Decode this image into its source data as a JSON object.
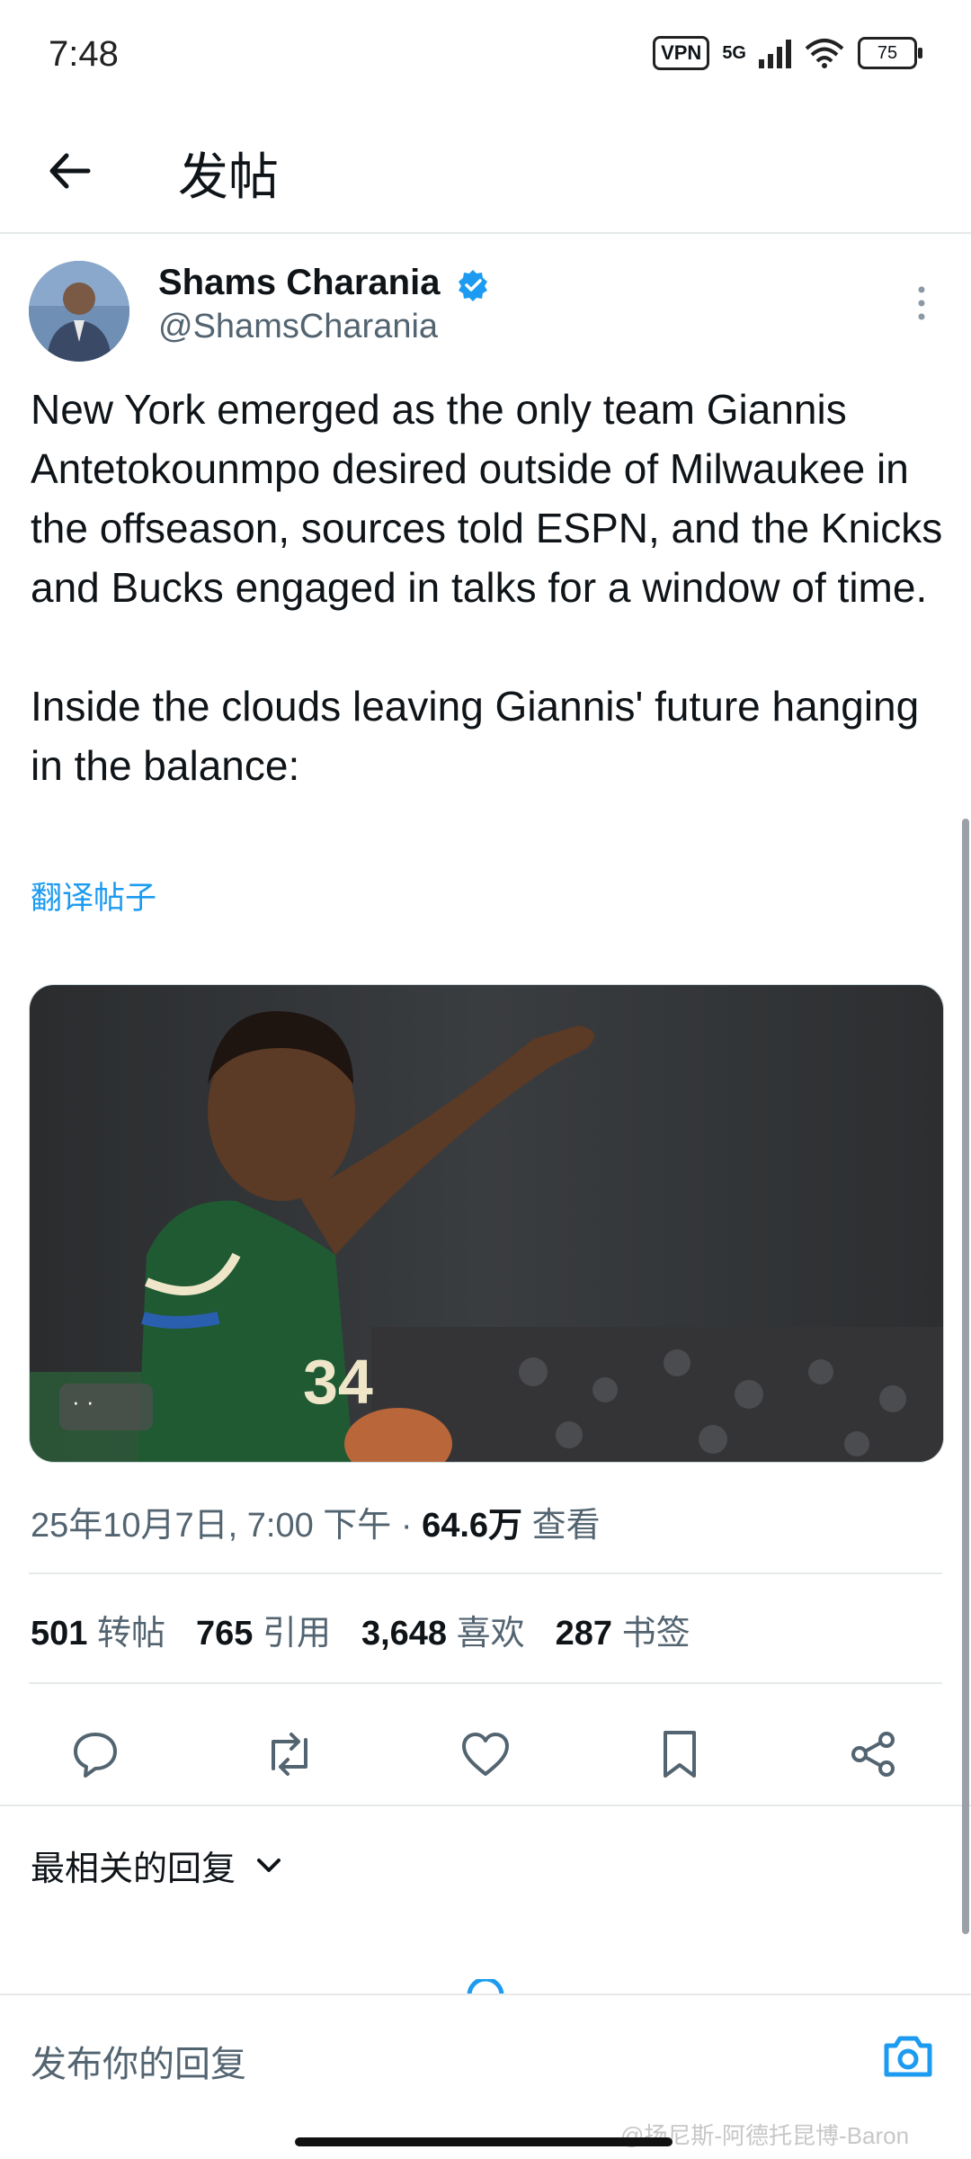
{
  "status": {
    "time": "7:48",
    "vpn": "VPN",
    "network": "5G",
    "battery": "75"
  },
  "header": {
    "title": "发帖"
  },
  "tweet": {
    "author_name": "Shams Charania",
    "author_handle": "@ShamsCharania",
    "body": "New York emerged as the only team Giannis Antetokounmpo desired outside of Milwaukee in the offseason, sources told ESPN, and the Knicks and Bucks engaged in talks for a window of time.\n\nInside the clouds leaving Giannis' future hanging in the balance:",
    "translate_label": "翻译帖子",
    "alt_badge": "· ·",
    "jersey_text": "34",
    "timestamp": "25年10月7日, 7:00 下午",
    "separator": "·",
    "views_count": "64.6万",
    "views_label": "查看"
  },
  "stats": [
    {
      "count": "501",
      "label": "转帖"
    },
    {
      "count": "765",
      "label": "引用"
    },
    {
      "count": "3,648",
      "label": "喜欢"
    },
    {
      "count": "287",
      "label": "书签"
    }
  ],
  "actions": {
    "reply_icon": "reply-icon",
    "retweet_icon": "retweet-icon",
    "like_icon": "heart-icon",
    "bookmark_icon": "bookmark-icon",
    "share_icon": "share-icon"
  },
  "replies": {
    "sort_label": "最相关的回复",
    "compose_placeholder": "发布你的回复"
  },
  "watermark": "@扬尼斯-阿德托昆博-Baron",
  "colors": {
    "accent": "#1d9bf0",
    "text": "#0f1419",
    "secondary": "#536471",
    "border": "#e6e9eb"
  }
}
